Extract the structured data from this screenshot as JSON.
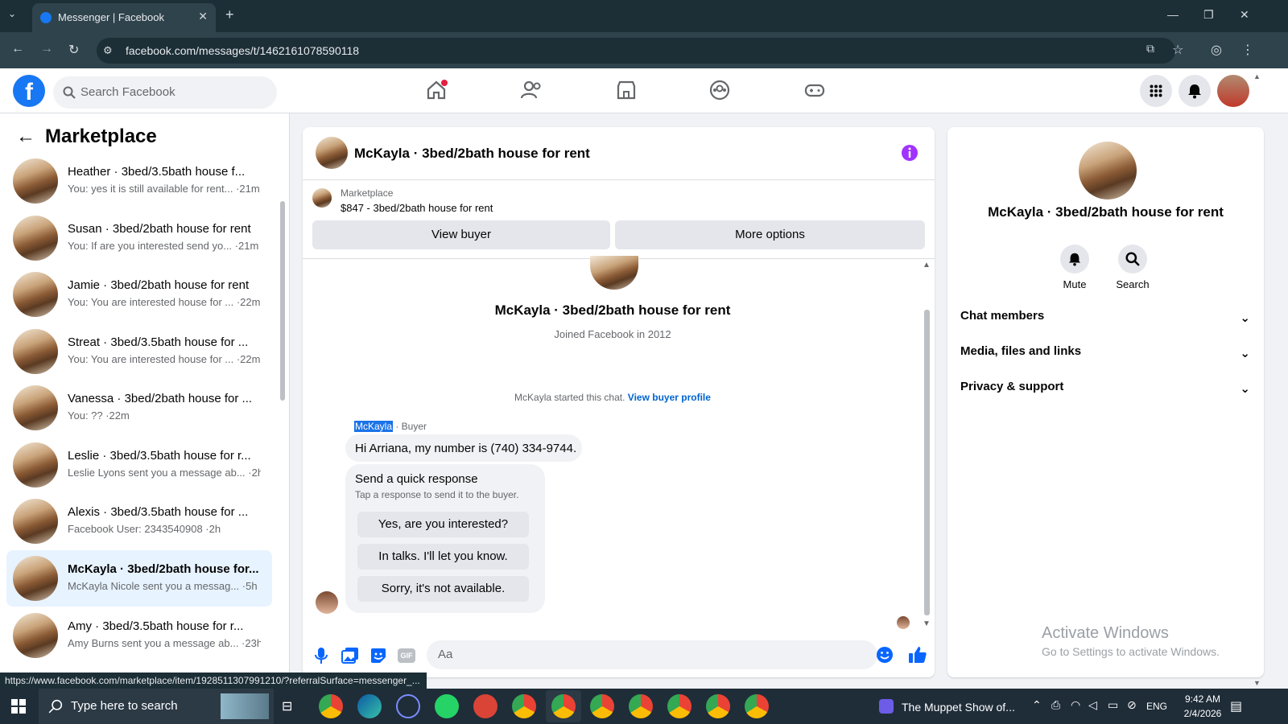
{
  "browser": {
    "tab_title": "Messenger | Facebook",
    "url": "facebook.com/messages/t/1462161078590118",
    "status_url": "https://www.facebook.com/marketplace/item/1928511307991210/?referralSurface=messenger_..."
  },
  "header": {
    "search_placeholder": "Search Facebook",
    "logo": "f"
  },
  "sidebar": {
    "title": "Marketplace",
    "conversations": [
      {
        "name": "Heather · 3bed/3.5bath house f...",
        "preview": "You: yes it is still available for rent... ·21m"
      },
      {
        "name": "Susan · 3bed/2bath house for rent",
        "preview": "You: If are you interested send yo... ·21m"
      },
      {
        "name": "Jamie · 3bed/2bath house for rent",
        "preview": "You: You are interested house for ... ·22m"
      },
      {
        "name": "Streat · 3bed/3.5bath house for ...",
        "preview": "You: You are interested house for ... ·22m"
      },
      {
        "name": "Vanessa · 3bed/2bath house for ...",
        "preview": "You: ?? ·22m"
      },
      {
        "name": "Leslie · 3bed/3.5bath house for r...",
        "preview": "Leslie Lyons sent you a message ab... ·2h"
      },
      {
        "name": "Alexis · 3bed/3.5bath house for ...",
        "preview": "Facebook User: 2343540908 ·2h"
      },
      {
        "name": "McKayla · 3bed/2bath house for...",
        "preview": "McKayla Nicole sent you a messag... ·5h"
      },
      {
        "name": "Amy · 3bed/3.5bath house for r...",
        "preview": "Amy Burns sent you a message ab... ·23h"
      }
    ]
  },
  "chat": {
    "title": "McKayla · 3bed/2bath house for rent",
    "listing_source": "Marketplace",
    "listing_title": "$847 - 3bed/2bath house for rent",
    "view_buyer": "View buyer",
    "more_options": "More options",
    "profile_name": "McKayla · 3bed/2bath house for rent",
    "joined": "Joined Facebook in 2012",
    "started": "McKayla started this chat.",
    "view_profile": "View buyer profile",
    "sender_name": "McKayla",
    "sender_role": " · Buyer",
    "message": "Hi Arriana, my number is (740) 334-9744.",
    "quick_title": "Send a quick response",
    "quick_sub": "Tap a response to send it to the buyer.",
    "quick_replies": [
      "Yes, are you interested?",
      "In talks. I'll let you know.",
      "Sorry, it's not available."
    ],
    "composer_placeholder": "Aa",
    "gif_label": "GIF"
  },
  "info": {
    "name": "McKayla · 3bed/2bath house for rent",
    "mute": "Mute",
    "search": "Search",
    "sections": [
      "Chat members",
      "Media, files and links",
      "Privacy & support"
    ]
  },
  "watermark": {
    "title": "Activate Windows",
    "sub": "Go to Settings to activate Windows."
  },
  "taskbar": {
    "search_placeholder": "Type here to search",
    "media_title": "The Muppet Show of...",
    "lang": "ENG",
    "time": "9:42 AM",
    "date": "2/4/2026"
  },
  "colors": {
    "fb_blue": "#1877f2",
    "accent_purple": "#a033ff",
    "selected": "#e7f3ff"
  }
}
